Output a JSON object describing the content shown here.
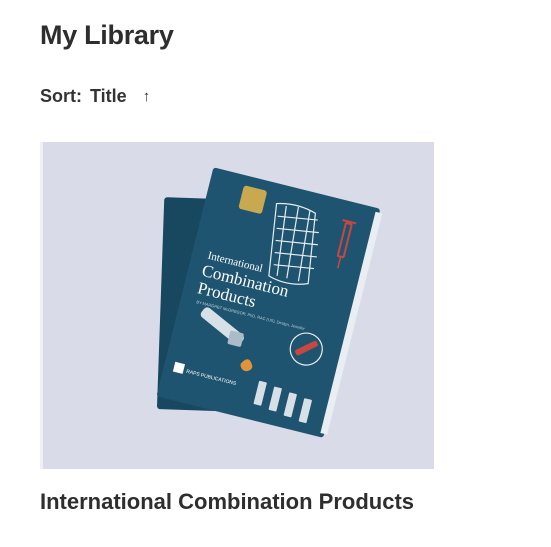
{
  "page": {
    "title": "My Library"
  },
  "sort": {
    "label": "Sort:",
    "value": "Title",
    "direction_glyph": "↑"
  },
  "books": [
    {
      "title": "International Combination Products",
      "cover": {
        "heading_line1": "International",
        "heading_line2": "Combination",
        "heading_line3": "Products",
        "byline": "BY MARGRET McGREGOR, PhD, RAC (US), Design, Jennifer",
        "publisher": "RAPS PUBLICATIONS",
        "colors": {
          "background": "#d9dbe8",
          "cover": "#1f5470",
          "cover_back": "#184760",
          "pages": "#e9eef2",
          "accent_red": "#c8473e",
          "accent_orange": "#e0933a"
        }
      }
    }
  ]
}
